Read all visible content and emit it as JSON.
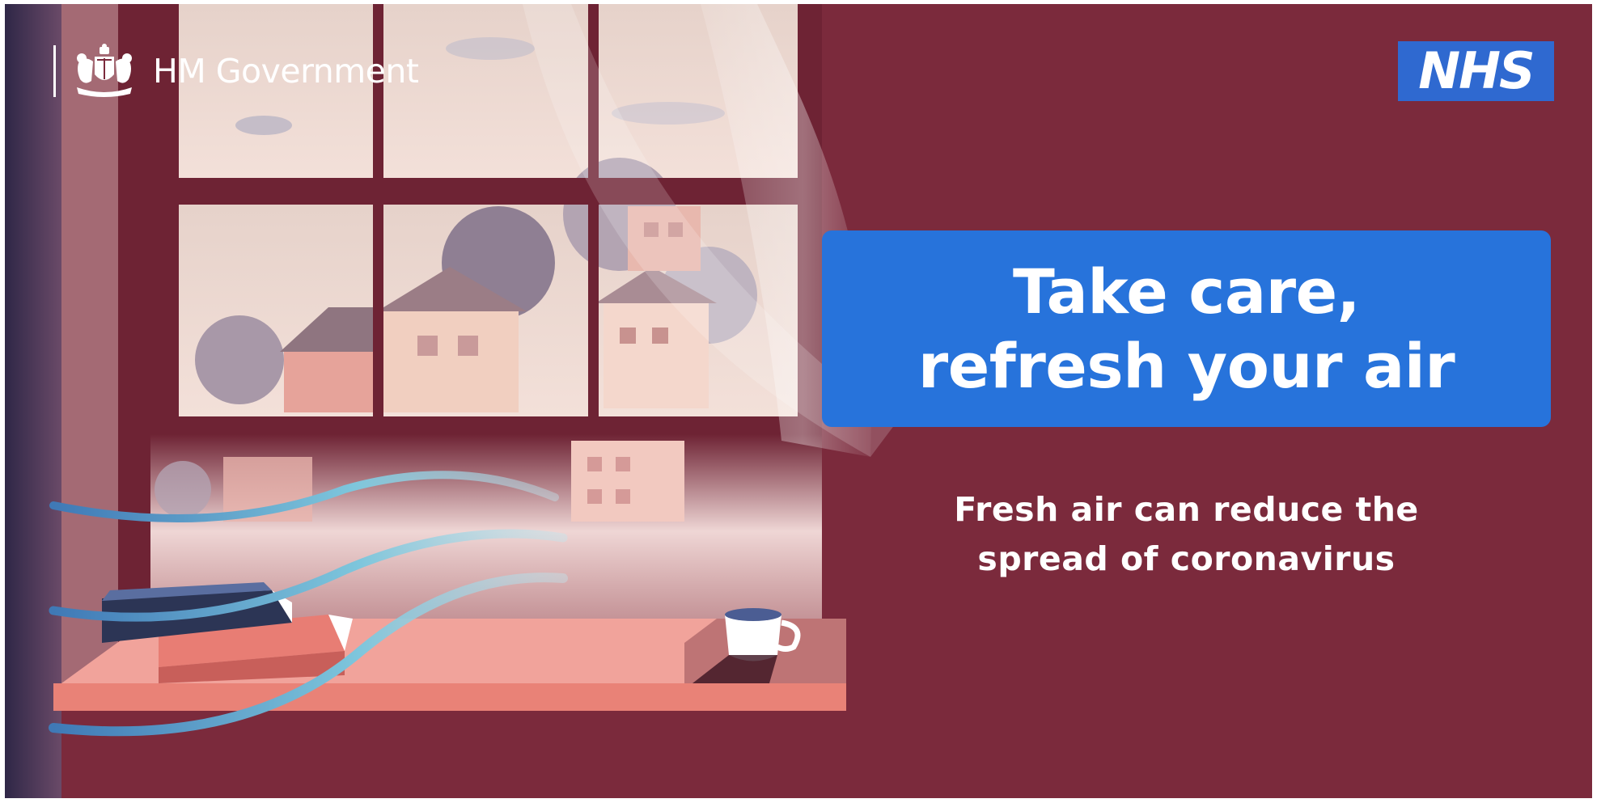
{
  "branding": {
    "government_label": "HM Government",
    "government_crest_icon": "royal-coat-of-arms-icon",
    "nhs_label": "NHS"
  },
  "headline": {
    "line1": "Take care,",
    "line2": "refresh your air"
  },
  "message": {
    "line1": "Fresh air can reduce the",
    "line2": "spread of coronavirus"
  },
  "illustration": {
    "description_icons": [
      "open-window-icon",
      "houses-icon",
      "trees-icon",
      "curtain-icon",
      "air-flow-icon",
      "books-icon",
      "tea-cup-icon"
    ]
  },
  "colors": {
    "background": "#7b2a3c",
    "headline_box": "#2773db",
    "nhs_blue": "#2f69d0",
    "text": "#ffffff"
  }
}
